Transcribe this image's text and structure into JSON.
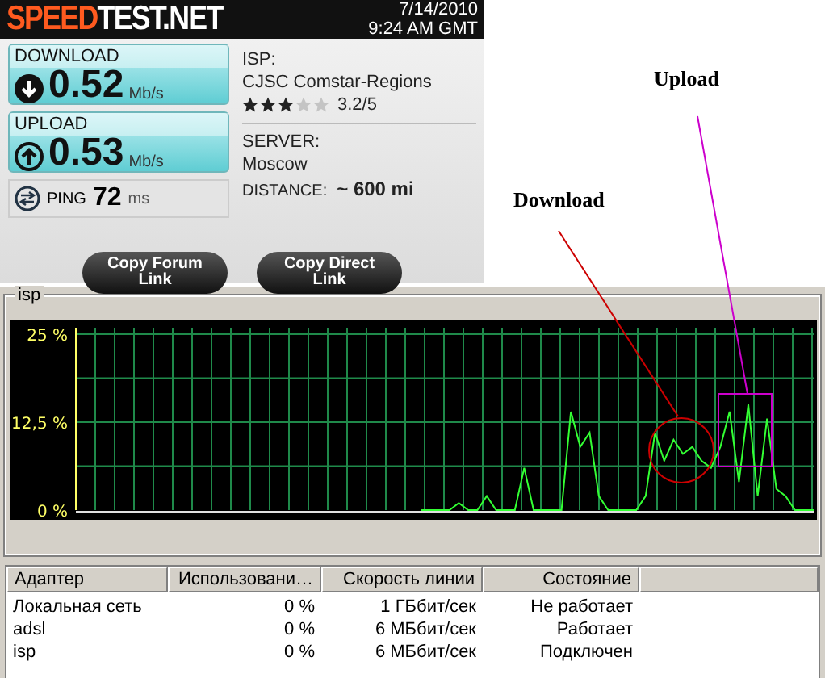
{
  "speedtest": {
    "logo_accent": "SPEED",
    "logo_rest": "TEST.NET",
    "date": "7/14/2010",
    "time": "9:24 AM GMT",
    "results": [
      {
        "kind": "download",
        "label": "DOWNLOAD",
        "value": "0.52",
        "unit": "Mb/s"
      },
      {
        "kind": "upload",
        "label": "UPLOAD",
        "value": "0.53",
        "unit": "Mb/s"
      }
    ],
    "ping": {
      "label": "PING",
      "value": "72",
      "unit": "ms"
    },
    "isp": {
      "label": "ISP:",
      "name": "CJSC Comstar-Regions",
      "stars": 3,
      "rating": "3.2/5"
    },
    "server": {
      "label": "SERVER:",
      "name": "Moscow",
      "distance_label": "DISTANCE:",
      "distance": "~ 600 mi"
    },
    "buttons": [
      "Copy Forum Link",
      "Copy Direct Link"
    ]
  },
  "annotations": [
    {
      "kind": "circle",
      "text": "Download",
      "color": "#cc0000"
    },
    {
      "kind": "box",
      "text": "Upload",
      "color": "#cc00cc"
    }
  ],
  "network": {
    "title": "isp",
    "chart_data": {
      "type": "line",
      "grid": true,
      "ylim": [
        0,
        25
      ],
      "yticks": [
        {
          "value": 0,
          "label": "0 %"
        },
        {
          "value": 12.5,
          "label": "12,5 %"
        },
        {
          "value": 25,
          "label": "25 %"
        }
      ],
      "series": [
        {
          "color": "#33ff33",
          "values": [
            null,
            null,
            null,
            null,
            null,
            null,
            null,
            null,
            null,
            null,
            null,
            null,
            null,
            null,
            null,
            null,
            null,
            null,
            null,
            null,
            null,
            null,
            null,
            null,
            null,
            null,
            null,
            null,
            null,
            null,
            null,
            null,
            null,
            null,
            null,
            null,
            null,
            0,
            0,
            0,
            0,
            1,
            0,
            0,
            2,
            0,
            0,
            0,
            6,
            0,
            0,
            0,
            0,
            14,
            9,
            11,
            2,
            0,
            0,
            0,
            0,
            2,
            11,
            7,
            10,
            8,
            9,
            7,
            6,
            9,
            14,
            4,
            15,
            2,
            13,
            3,
            2,
            0,
            0,
            0
          ]
        }
      ]
    },
    "table": {
      "columns": [
        "Адаптер",
        "Использовани…",
        "Скорость линии",
        "Состояние"
      ],
      "rows": [
        [
          "Локальная сеть",
          "0 %",
          "1 ГБбит/сек",
          "Не работает"
        ],
        [
          "adsl",
          "0 %",
          "6 МБбит/сек",
          "Работает"
        ],
        [
          "isp",
          "0 %",
          "6 МБбит/сек",
          "Подключен"
        ]
      ]
    }
  }
}
